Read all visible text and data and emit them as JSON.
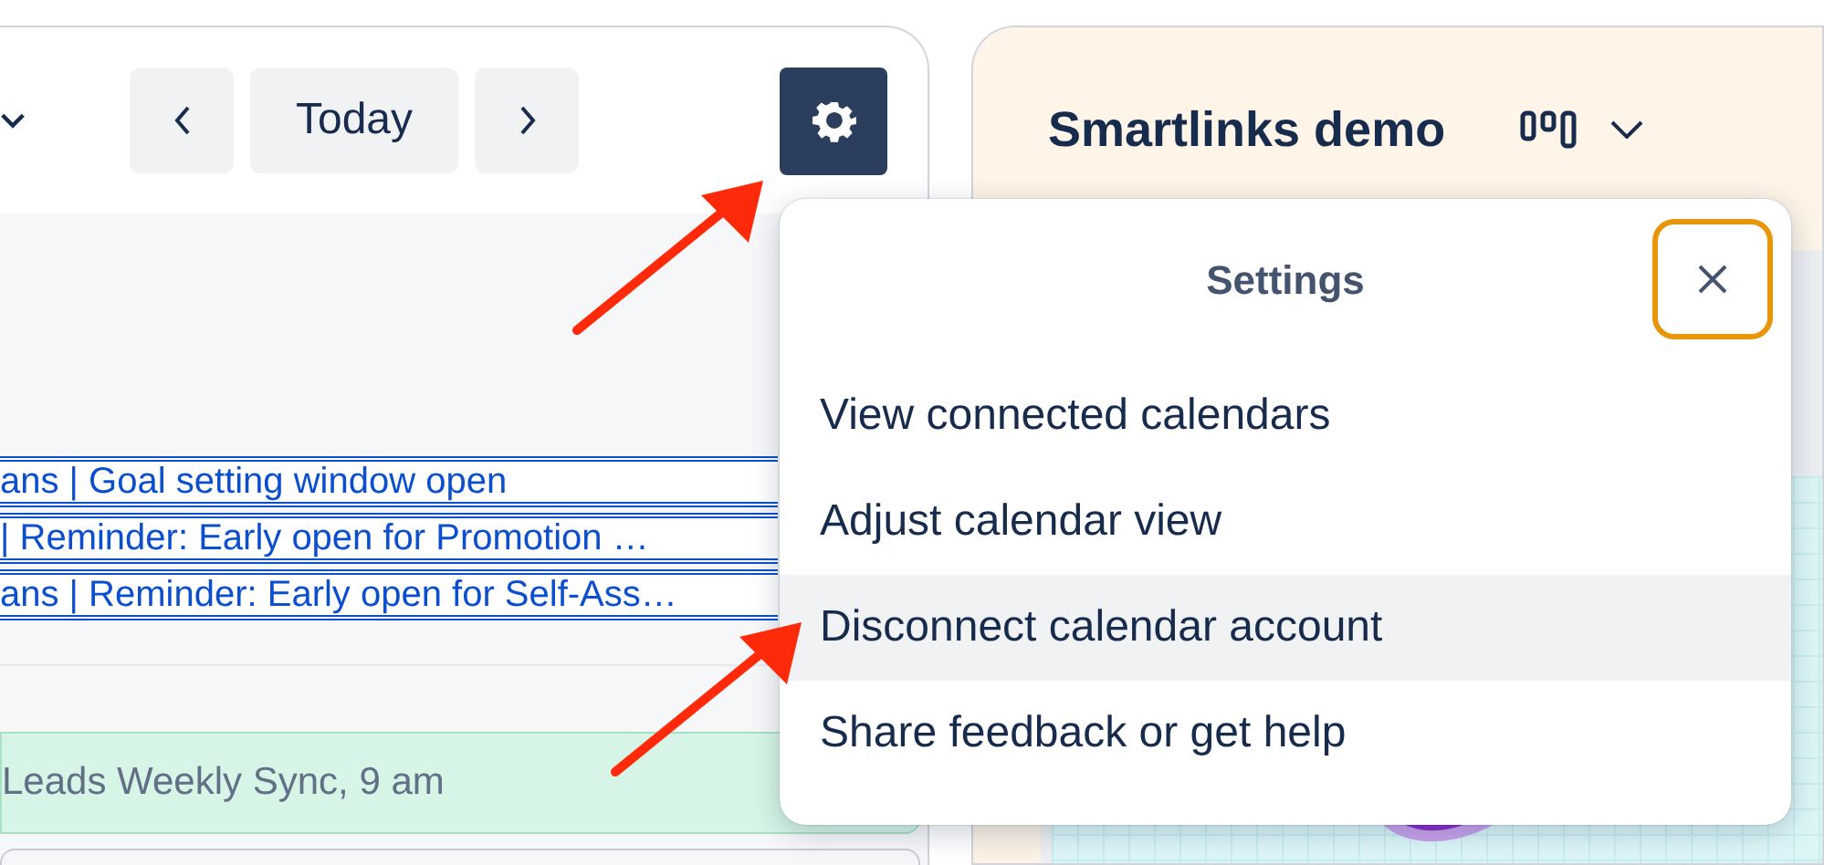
{
  "calendar": {
    "toolbar": {
      "today_button": "Today"
    },
    "events": [
      {
        "kind": "banner",
        "text": "ans | Goal setting window open"
      },
      {
        "kind": "banner",
        "text": "| Reminder: Early open for Promotion …"
      },
      {
        "kind": "banner",
        "text": "ans | Reminder: Early open for Self-Ass…"
      },
      {
        "kind": "meeting",
        "text": "Leads Weekly Sync, 9 am",
        "color": "#d6f5e6"
      }
    ]
  },
  "board": {
    "title": "Smartlinks demo"
  },
  "settings_menu": {
    "title": "Settings",
    "items": [
      {
        "label": "View connected calendars",
        "selected": false
      },
      {
        "label": "Adjust calendar view",
        "selected": false
      },
      {
        "label": "Disconnect calendar account",
        "selected": true
      },
      {
        "label": "Share feedback or get help",
        "selected": false
      }
    ]
  }
}
